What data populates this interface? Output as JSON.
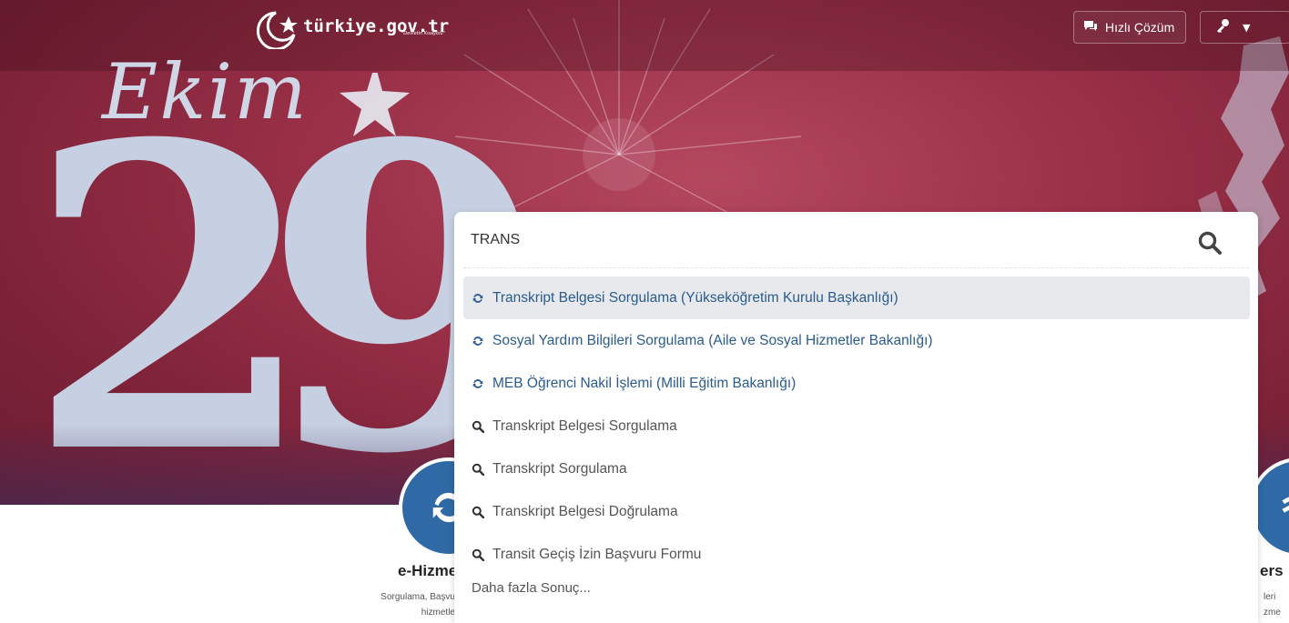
{
  "header": {
    "logo_text": "türkiye.gov.tr",
    "logo_tagline": "\"Devletin Kısayolu\"",
    "quick_solution_label": "Hızlı Çözüm"
  },
  "banner": {
    "month_text": "Ekim",
    "day_text": "29"
  },
  "search": {
    "query": "TRANS",
    "service_results": [
      {
        "label": "Transkript Belgesi Sorgulama (Yükseköğretim Kurulu Başkanlığı)"
      },
      {
        "label": "Sosyal Yardım Bilgileri Sorgulama (Aile ve Sosyal Hizmetler Bakanlığı)"
      },
      {
        "label": "MEB Öğrenci Nakil İşlemi (Milli Eğitim Bakanlığı)"
      }
    ],
    "query_results": [
      {
        "label": "Transkript Belgesi Sorgulama"
      },
      {
        "label": "Transkript Sorgulama"
      },
      {
        "label": "Transkript Belgesi Doğrulama"
      },
      {
        "label": "Transit Geçiş İzin Başvuru Formu"
      }
    ],
    "more_label": "Daha fazla Sonuç..."
  },
  "cards": {
    "left_title": "e-Hizme",
    "left_desc_line1": "Sorgulama, Başvu",
    "left_desc_line2": "hizmetle",
    "right_title": "ers",
    "right_desc_line1": "leri",
    "right_desc_line2": "zme"
  },
  "colors": {
    "hero_red": "#9a3048",
    "service_link": "#2a5c8f",
    "card_blue": "#2f6aa6",
    "active_row": "#e7e9ec"
  },
  "icons": {
    "service_result": "refresh-icon",
    "query_result": "search-icon",
    "quick_solution": "chat-icon",
    "login": "key-icon"
  }
}
